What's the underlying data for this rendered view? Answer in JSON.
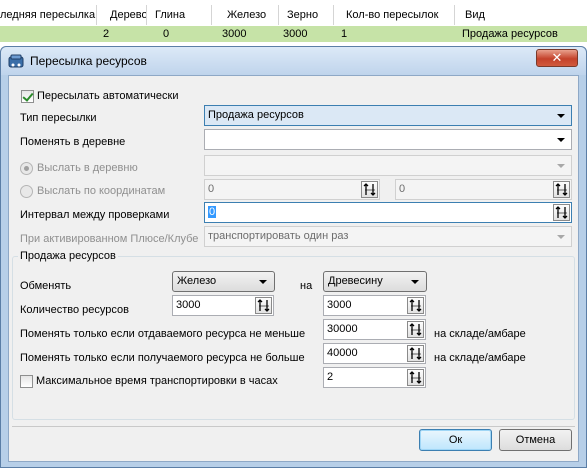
{
  "background_grid": {
    "columns": [
      "ледняя пересылка",
      "Дерево",
      "Глина",
      "Железо",
      "Зерно",
      "Кол-во пересылок",
      "Вид"
    ],
    "row": [
      "2",
      "0",
      "3000",
      "3000",
      "1",
      "Продажа ресурсов"
    ]
  },
  "dialog": {
    "title": "Пересылка ресурсов",
    "close_label": "✕",
    "auto_send_label": "Пересылать автоматически",
    "auto_send_checked": true,
    "send_type_label": "Тип пересылки",
    "send_type_value": "Продажа ресурсов",
    "change_in_village_label": "Поменять в деревне",
    "change_in_village_value": "",
    "send_to_village_label": "Выслать в деревню",
    "send_to_village_value": "",
    "send_by_coords_label": "Выслать по координатам",
    "coord_x": "0",
    "coord_y": "0",
    "check_interval_label": "Интервал между проверками",
    "check_interval_value": "0",
    "plus_club_label": "При активированном Плюсе/Клубе",
    "plus_club_value": "транспортировать один раз",
    "sale": {
      "group_title": "Продажа ресурсов",
      "exchange_label": "Обменять",
      "exchange_from": "Железо",
      "on_label": "на",
      "exchange_to": "Древесину",
      "quantity_label": "Количество ресурсов",
      "quantity_from": "3000",
      "quantity_to": "3000",
      "min_give_label": "Поменять только если отдаваемого ресурса не меньше",
      "min_give_value": "30000",
      "min_give_suffix": "на складе/амбаре",
      "max_get_label": "Поменять только если получаемого ресурса не больше",
      "max_get_value": "40000",
      "max_get_suffix": "на складе/амбаре",
      "max_time_label": "Максимальное время транспортировки в часах",
      "max_time_checked": false,
      "max_time_value": "2"
    },
    "ok_label": "Ок",
    "cancel_label": "Отмена"
  },
  "colors": {
    "selected_row": "#c6e3a7",
    "dialog_frame": "#b7cfe8",
    "close_button": "#c4422b"
  }
}
